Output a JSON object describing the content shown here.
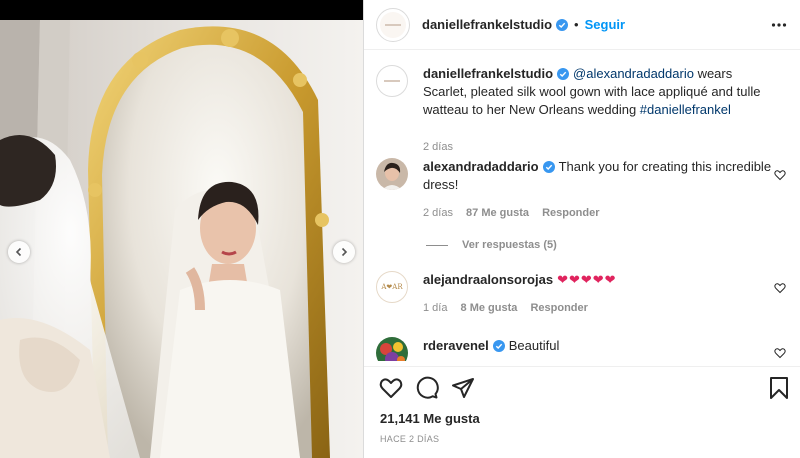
{
  "header": {
    "username": "daniellefrankelstudio",
    "separator": "•",
    "follow_label": "Seguir"
  },
  "caption": {
    "username": "daniellefrankelstudio",
    "mention": "@alexandradaddario",
    "text": " wears Scarlet, pleated silk wool gown with lace appliqué and tulle watteau to her New Orleans wedding ",
    "hashtag": "#daniellefrankel",
    "time": "2 días"
  },
  "comments": [
    {
      "username": "alexandradaddario",
      "text": "Thank you for creating this incredible dress!",
      "time": "2 días",
      "likes": "87 Me gusta",
      "reply_label": "Responder",
      "view_replies": "Ver respuestas (5)"
    },
    {
      "username": "alejandraalonsorojas",
      "text": "❤❤❤❤❤",
      "time": "1 día",
      "likes": "8 Me gusta",
      "reply_label": "Responder",
      "avatar_text": "A❤AR"
    },
    {
      "username": "rderavenel",
      "text": "Beautiful"
    }
  ],
  "footer": {
    "likes": "21,141 Me gusta",
    "posted": "HACE 2 DÍAS"
  },
  "icons": {
    "verified": "verified-badge-icon",
    "more": "more-options-icon",
    "like": "heart-icon",
    "comment": "comment-bubble-icon",
    "share": "paper-plane-icon",
    "save": "bookmark-icon"
  },
  "colors": {
    "link": "#0095f6",
    "mention": "#00376b",
    "verified": "#3897f0",
    "heart_red": "#e0245e",
    "muted": "#8e8e8e"
  }
}
